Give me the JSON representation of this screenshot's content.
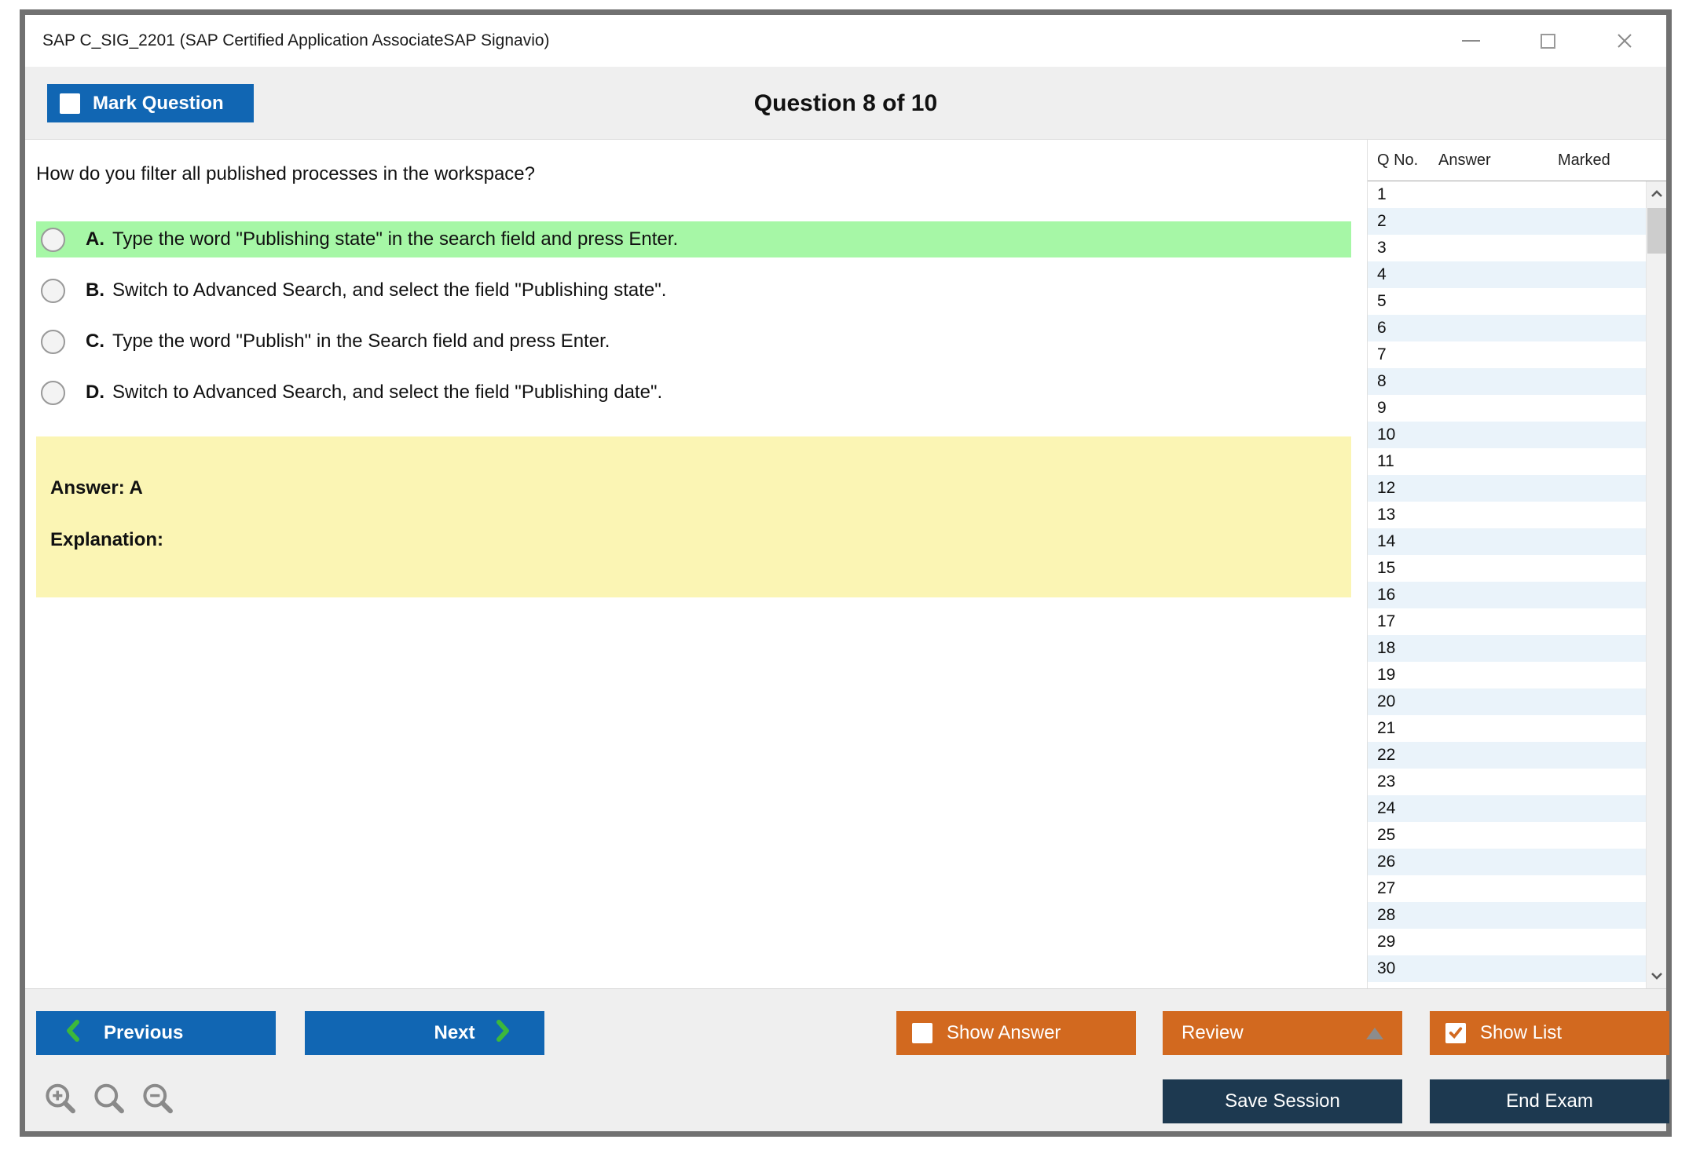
{
  "window": {
    "title": "SAP C_SIG_2201 (SAP Certified Application AssociateSAP Signavio)"
  },
  "header": {
    "mark_question_label": "Mark Question",
    "question_counter": "Question 8 of 10"
  },
  "question": {
    "text": "How do you filter all published processes in the workspace?",
    "options": [
      {
        "letter": "A.",
        "text": "Type the word \"Publishing state\" in the search field and press Enter.",
        "highlighted": true
      },
      {
        "letter": "B.",
        "text": "Switch to Advanced Search, and select the field \"Publishing state\".",
        "highlighted": false
      },
      {
        "letter": "C.",
        "text": "Type the word \"Publish\" in the Search field and press Enter.",
        "highlighted": false
      },
      {
        "letter": "D.",
        "text": "Switch to Advanced Search, and select the field \"Publishing date\".",
        "highlighted": false
      }
    ],
    "answer_label": "Answer: A",
    "explanation_label": "Explanation:"
  },
  "sidebar": {
    "columns": [
      "Q No.",
      "Answer",
      "Marked"
    ],
    "rows": [
      "1",
      "2",
      "3",
      "4",
      "5",
      "6",
      "7",
      "8",
      "9",
      "10",
      "11",
      "12",
      "13",
      "14",
      "15",
      "16",
      "17",
      "18",
      "19",
      "20",
      "21",
      "22",
      "23",
      "24",
      "25",
      "26",
      "27",
      "28",
      "29",
      "30"
    ]
  },
  "footer": {
    "previous_label": "Previous",
    "next_label": "Next",
    "show_answer_label": "Show Answer",
    "review_label": "Review",
    "show_list_label": "Show List",
    "save_session_label": "Save Session",
    "end_exam_label": "End Exam"
  },
  "colors": {
    "blue": "#1166b3",
    "orange": "#d2691f",
    "navy": "#1d3950",
    "green_highlight": "#a6f7a6",
    "yellow_box": "#fbf5b4",
    "row_stripe": "#eaf3fa",
    "chevron_green": "#3cb83c"
  }
}
